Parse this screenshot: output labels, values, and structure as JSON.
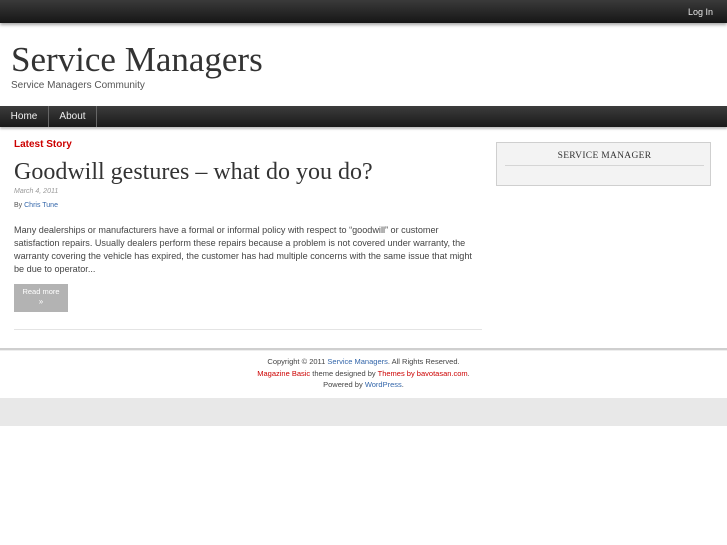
{
  "topbar": {
    "login_label": "Log In"
  },
  "site": {
    "title": "Service Managers",
    "description": "Service Managers Community"
  },
  "nav": {
    "items": [
      {
        "label": "Home"
      },
      {
        "label": "About"
      }
    ]
  },
  "main": {
    "section_label": "Latest Story",
    "post": {
      "title": "Goodwill gestures – what do you do?",
      "date": "March 4, 2011",
      "by_label": "By",
      "author": "Chris Tune",
      "excerpt": "Many dealerships or manufacturers have a formal or informal policy with respect to “goodwill” or customer satisfaction repairs. Usually dealers perform these repairs because a problem is not covered under warranty, the warranty covering the vehicle has expired, the customer has had multiple concerns with the same issue that might be due to operator...",
      "read_more": "Read more",
      "read_more_arrow": "»"
    }
  },
  "sidebar": {
    "widget_title": "SERVICE MANAGER"
  },
  "footer": {
    "copyright_prefix": "Copyright © 2011",
    "site_link": "Service Managers",
    "copyright_suffix": ". All Rights Reserved.",
    "theme_link": "Magazine Basic",
    "theme_mid": "theme designed by",
    "themes_link": "Themes by bavotasan.com",
    "theme_end": ".",
    "powered_prefix": "Powered by",
    "powered_link": "WordPress",
    "powered_end": "."
  }
}
